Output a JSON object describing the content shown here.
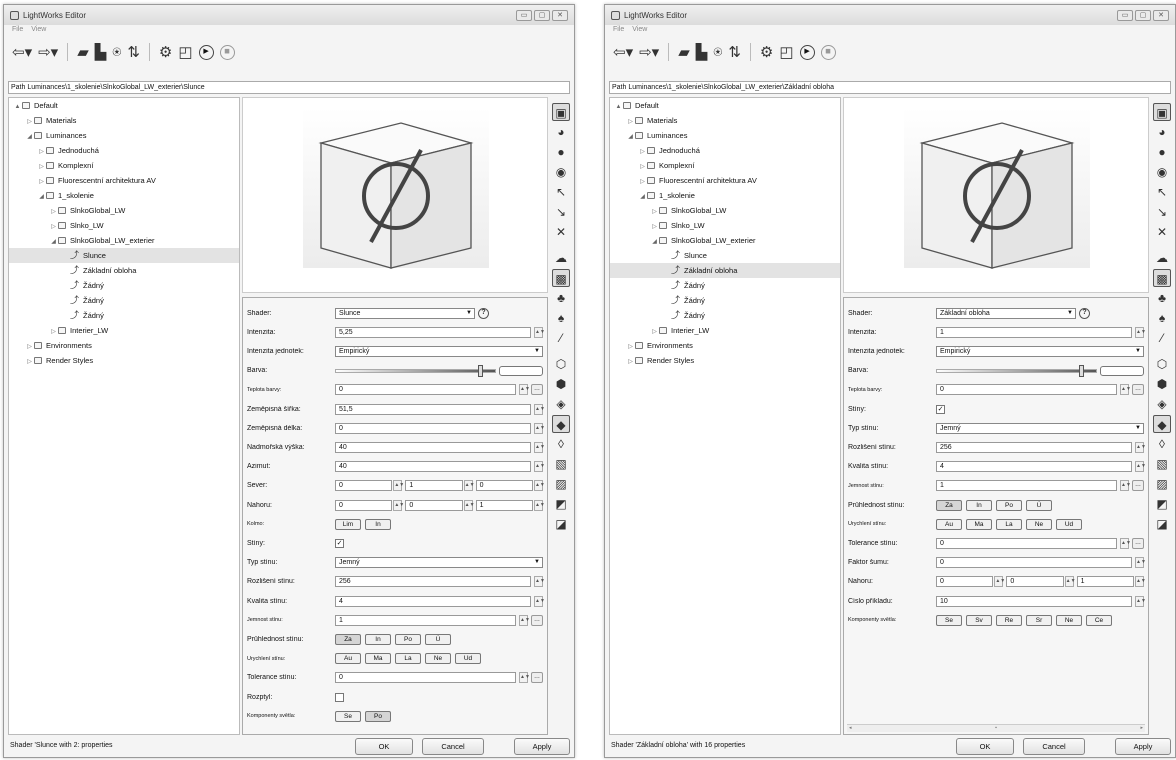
{
  "windows": [
    {
      "title": "LightWorks Editor",
      "menu": [
        "File",
        "View"
      ],
      "path": "Path Luminances\\1_skolenie\\SlnkoGlobal_LW_exterier\\Slunce",
      "tree": [
        {
          "label": "Default",
          "level": 0,
          "twisty": "▲",
          "icon": "library"
        },
        {
          "label": "Materials",
          "level": 1,
          "twisty": "▷",
          "icon": "folder"
        },
        {
          "label": "Luminances",
          "level": 1,
          "twisty": "◢",
          "icon": "folder"
        },
        {
          "label": "Jednoduchá",
          "level": 2,
          "twisty": "▷",
          "icon": "folder"
        },
        {
          "label": "Komplexní",
          "level": 2,
          "twisty": "▷",
          "icon": "folder"
        },
        {
          "label": "Fluorescentní architektura AV",
          "level": 2,
          "twisty": "▷",
          "icon": "folder"
        },
        {
          "label": "1_skolenie",
          "level": 2,
          "twisty": "◢",
          "icon": "folder"
        },
        {
          "label": "SlnkoGlobal_LW",
          "level": 3,
          "twisty": "▷",
          "icon": "folder"
        },
        {
          "label": "Slnko_LW",
          "level": 3,
          "twisty": "▷",
          "icon": "folder"
        },
        {
          "label": "SlnkoGlobal_LW_exterier",
          "level": 3,
          "twisty": "◢",
          "icon": "folder"
        },
        {
          "label": "Slunce",
          "level": 4,
          "twisty": "",
          "icon": "light",
          "selected": true
        },
        {
          "label": "Základní obloha",
          "level": 4,
          "twisty": "",
          "icon": "light"
        },
        {
          "label": "Žádný",
          "level": 4,
          "twisty": "",
          "icon": "light"
        },
        {
          "label": "Žádný",
          "level": 4,
          "twisty": "",
          "icon": "light"
        },
        {
          "label": "Žádný",
          "level": 4,
          "twisty": "",
          "icon": "light"
        },
        {
          "label": "Interier_LW",
          "level": 3,
          "twisty": "▷",
          "icon": "folder"
        },
        {
          "label": "Environments",
          "level": 1,
          "twisty": "▷",
          "icon": "folder"
        },
        {
          "label": "Render Styles",
          "level": 1,
          "twisty": "▷",
          "icon": "folder"
        }
      ],
      "props": [
        {
          "label": "Shader:",
          "type": "dropdown",
          "value": "Slunce",
          "help": "?"
        },
        {
          "label": "Intenzita:",
          "type": "input",
          "value": "5,25",
          "spin": true
        },
        {
          "label": "Intenzita jednotek:",
          "type": "dropdown",
          "value": "Empirický"
        },
        {
          "label": "Barva:",
          "type": "color"
        },
        {
          "label": "Teplota barvy:",
          "type": "input",
          "value": "0",
          "spin": true,
          "ref": true,
          "small": true
        },
        {
          "label": "Zeměpisná šířka:",
          "type": "input",
          "value": "51,5",
          "spin": true
        },
        {
          "label": "Zeměpisná délka:",
          "type": "input",
          "value": "0",
          "spin": true
        },
        {
          "label": "Nadmořská výška:",
          "type": "input",
          "value": "40",
          "spin": true
        },
        {
          "label": "Azimut:",
          "type": "input",
          "value": "40",
          "spin": true
        },
        {
          "label": "Sever:",
          "type": "vector",
          "values": [
            "0",
            "1",
            "0"
          ]
        },
        {
          "label": "Nahoru:",
          "type": "vector",
          "values": [
            "0",
            "0",
            "1"
          ]
        },
        {
          "label": "Kolmo:",
          "type": "buttons",
          "buttons": [
            "Lim",
            "In"
          ],
          "small": true
        },
        {
          "label": "Stíny:",
          "type": "check",
          "checked": "✓"
        },
        {
          "label": "Typ stínu:",
          "type": "dropdown",
          "value": "Jemný"
        },
        {
          "label": "Rozlišení stínu:",
          "type": "input",
          "value": "256",
          "spin": true
        },
        {
          "label": "Kvalita stínu:",
          "type": "input",
          "value": "4",
          "spin": true
        },
        {
          "label": "Jemnost stínu:",
          "type": "input",
          "value": "1",
          "spin": true,
          "ref": true,
          "small": true
        },
        {
          "label": "Průhlednost stínu:",
          "type": "buttons",
          "buttons": [
            "Za",
            "In",
            "Po",
            "Ú"
          ],
          "on": 0
        },
        {
          "label": "Urychlení stínu:",
          "type": "buttons",
          "buttons": [
            "Au",
            "Ma",
            "La",
            "Ne",
            "Ud"
          ],
          "small": true
        },
        {
          "label": "Tolerance stínu:",
          "type": "input",
          "value": "0",
          "spin": true,
          "ref": true
        },
        {
          "label": "Rozptyl:",
          "type": "check",
          "checked": ""
        },
        {
          "label": "Komponenty světla:",
          "type": "buttons",
          "buttons": [
            "Se",
            "Po"
          ],
          "on": 1,
          "small": true
        }
      ],
      "status": "Shader 'Slunce with 2: properties",
      "buttons": {
        "ok": "OK",
        "cancel": "Cancel",
        "apply": "Apply"
      },
      "scrollbar": false
    },
    {
      "title": "LightWorks Editor",
      "menu": [
        "File",
        "View"
      ],
      "path": "Path Luminances\\1_skolenie\\SlnkoGlobal_LW_exterier\\Základní obloha",
      "tree": [
        {
          "label": "Default",
          "level": 0,
          "twisty": "▲",
          "icon": "library"
        },
        {
          "label": "Materials",
          "level": 1,
          "twisty": "▷",
          "icon": "folder"
        },
        {
          "label": "Luminances",
          "level": 1,
          "twisty": "◢",
          "icon": "folder"
        },
        {
          "label": "Jednoduchá",
          "level": 2,
          "twisty": "▷",
          "icon": "folder"
        },
        {
          "label": "Komplexní",
          "level": 2,
          "twisty": "▷",
          "icon": "folder"
        },
        {
          "label": "Fluorescentní architektura AV",
          "level": 2,
          "twisty": "▷",
          "icon": "folder"
        },
        {
          "label": "1_skolenie",
          "level": 2,
          "twisty": "◢",
          "icon": "folder"
        },
        {
          "label": "SlnkoGlobal_LW",
          "level": 3,
          "twisty": "▷",
          "icon": "folder"
        },
        {
          "label": "Slnko_LW",
          "level": 3,
          "twisty": "▷",
          "icon": "folder"
        },
        {
          "label": "SlnkoGlobal_LW_exterier",
          "level": 3,
          "twisty": "◢",
          "icon": "folder"
        },
        {
          "label": "Slunce",
          "level": 4,
          "twisty": "",
          "icon": "light"
        },
        {
          "label": "Základní obloha",
          "level": 4,
          "twisty": "",
          "icon": "light",
          "selected": true
        },
        {
          "label": "Žádný",
          "level": 4,
          "twisty": "",
          "icon": "light"
        },
        {
          "label": "Žádný",
          "level": 4,
          "twisty": "",
          "icon": "light"
        },
        {
          "label": "Žádný",
          "level": 4,
          "twisty": "",
          "icon": "light"
        },
        {
          "label": "Interier_LW",
          "level": 3,
          "twisty": "▷",
          "icon": "folder"
        },
        {
          "label": "Environments",
          "level": 1,
          "twisty": "▷",
          "icon": "folder"
        },
        {
          "label": "Render Styles",
          "level": 1,
          "twisty": "▷",
          "icon": "folder"
        }
      ],
      "props": [
        {
          "label": "Shader:",
          "type": "dropdown",
          "value": "Základní obloha",
          "help": "?"
        },
        {
          "label": "Intenzita:",
          "type": "input",
          "value": "1",
          "spin": true
        },
        {
          "label": "Intenzita jednotek:",
          "type": "dropdown",
          "value": "Empirický"
        },
        {
          "label": "Barva:",
          "type": "color"
        },
        {
          "label": "Teplota barvy:",
          "type": "input",
          "value": "0",
          "spin": true,
          "ref": true,
          "small": true
        },
        {
          "label": "Stíny:",
          "type": "check",
          "checked": "✓"
        },
        {
          "label": "Typ stínu:",
          "type": "dropdown",
          "value": "Jemný"
        },
        {
          "label": "Rozlišení stínu:",
          "type": "input",
          "value": "256",
          "spin": true
        },
        {
          "label": "Kvalita stínu:",
          "type": "input",
          "value": "4",
          "spin": true
        },
        {
          "label": "Jemnost stínu:",
          "type": "input",
          "value": "1",
          "spin": true,
          "ref": true,
          "small": true
        },
        {
          "label": "Průhlednost stínu:",
          "type": "buttons",
          "buttons": [
            "Za",
            "In",
            "Po",
            "Ú"
          ],
          "on": 0
        },
        {
          "label": "Urychlení stínu:",
          "type": "buttons",
          "buttons": [
            "Au",
            "Ma",
            "La",
            "Ne",
            "Ud"
          ],
          "small": true
        },
        {
          "label": "Tolerance stínu:",
          "type": "input",
          "value": "0",
          "spin": true,
          "ref": true
        },
        {
          "label": "Faktor šumu:",
          "type": "input",
          "value": "0",
          "spin": true
        },
        {
          "label": "Nahoru:",
          "type": "vector",
          "values": [
            "0",
            "0",
            "1"
          ]
        },
        {
          "label": "Číslo příkladu:",
          "type": "input",
          "value": "10",
          "spin": true
        },
        {
          "label": "Komponenty světla:",
          "type": "buttons",
          "buttons": [
            "Se",
            "Sv",
            "Re",
            "Sr",
            "Ne",
            "Ce"
          ],
          "small": true
        }
      ],
      "status": "Shader 'Základní obloha' with 16 properties",
      "buttons": {
        "ok": "OK",
        "cancel": "Cancel",
        "apply": "Apply"
      },
      "scrollbar": true
    }
  ],
  "toolbar_icons": [
    "back-arrow-icon",
    "forward-arrow-icon",
    "open-folder-icon",
    "import-icon",
    "export-icon",
    "sort-icon",
    "settings-icon",
    "layout-icon",
    "play-icon",
    "stop-icon"
  ],
  "side_icons": [
    "material-icon",
    "sphere-icon",
    "small-sphere-icon",
    "dark-sphere-icon",
    "cursor-icon",
    "paint-cursor-icon",
    "cross-icon",
    "cloud-icon",
    "sky-icon",
    "light-bulb-icon",
    "spot-icon",
    "line-icon",
    "cube-icon",
    "cube-light-icon",
    "cube-shadow-icon",
    "cube-selected-icon",
    "cube-scatter-icon",
    "cube-fill-icon",
    "cube-edit-icon",
    "cube-partial-icon",
    "cube-outline-icon"
  ]
}
